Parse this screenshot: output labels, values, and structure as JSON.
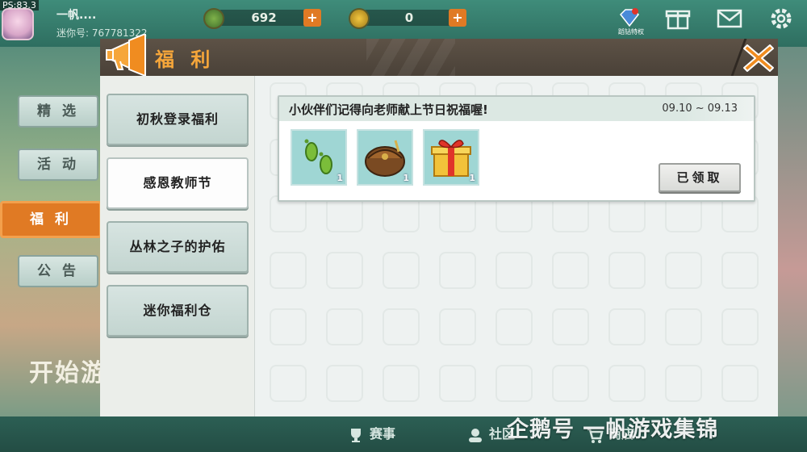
{
  "hud": {
    "fps": "PS:83.3",
    "username": "一帆....",
    "user_id": "迷你号: 767781322",
    "currency_green": "692",
    "currency_gold": "0",
    "plus_symbol": "+",
    "top_icon_label": "蹈钻特权"
  },
  "side_tabs": [
    {
      "label": "精 选"
    },
    {
      "label": "活 动"
    },
    {
      "label": "福 利"
    },
    {
      "label": "公 告"
    }
  ],
  "start_text": "开始游",
  "dialog": {
    "title": "福 利",
    "menu": [
      {
        "label": "初秋登录福利"
      },
      {
        "label": "感恩教师节"
      },
      {
        "label": "丛林之子的护佑"
      },
      {
        "label": "迷你福利仓"
      }
    ],
    "active_menu_index": 1,
    "card": {
      "title": "小伙伴们记得向老师献上节日祝福喔!",
      "date_range": "09.10 ~ 09.13",
      "rewards": [
        {
          "icon": "footprints-icon",
          "count": "1"
        },
        {
          "icon": "backpack-icon",
          "count": "1"
        },
        {
          "icon": "gift-box-icon",
          "count": "1"
        }
      ],
      "button_label": "已领取"
    }
  },
  "bottom_bar": {
    "items": [
      {
        "label": "赛事"
      },
      {
        "label": "社区"
      },
      {
        "label": "商店"
      }
    ],
    "watermark": "企鹅号 一帆游戏集锦"
  },
  "colors": {
    "accent_orange": "#e07a24",
    "title_orange": "#f6a63a",
    "header_brown": "#4a4138",
    "reward_bg": "#9fd6d4"
  }
}
